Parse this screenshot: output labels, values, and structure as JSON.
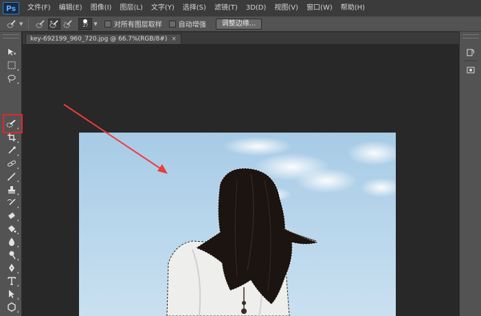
{
  "app": {
    "logo": "Ps"
  },
  "menu": {
    "items": [
      "文件(F)",
      "编辑(E)",
      "图像(I)",
      "图层(L)",
      "文字(Y)",
      "选择(S)",
      "滤镜(T)",
      "3D(D)",
      "视图(V)",
      "窗口(W)",
      "帮助(H)"
    ]
  },
  "options": {
    "brush_size": "27",
    "sample_all_layers": "对所有图层取样",
    "auto_enhance": "自动增强",
    "refine_edge": "调整边缘..."
  },
  "document": {
    "tab_label": "key-692199_960_720.jpg @ 66.7%(RGB/8#)",
    "close_glyph": "×"
  },
  "tools": [
    {
      "name": "move-tool",
      "icon": "move-icon"
    },
    {
      "name": "marquee-tool",
      "icon": "marquee-icon"
    },
    {
      "name": "lasso-tool",
      "icon": "lasso-icon"
    },
    {
      "name": "quick-selection-tool",
      "icon": "quick-selection-icon",
      "active": true
    },
    {
      "name": "crop-tool",
      "icon": "crop-icon"
    },
    {
      "name": "eyedropper-tool",
      "icon": "eyedropper-icon"
    },
    {
      "name": "healing-brush-tool",
      "icon": "healing-icon"
    },
    {
      "name": "brush-tool",
      "icon": "brush-icon"
    },
    {
      "name": "clone-stamp-tool",
      "icon": "stamp-icon"
    },
    {
      "name": "history-brush-tool",
      "icon": "history-brush-icon"
    },
    {
      "name": "eraser-tool",
      "icon": "eraser-icon"
    },
    {
      "name": "paint-bucket-tool",
      "icon": "bucket-icon"
    },
    {
      "name": "blur-tool",
      "icon": "blur-icon"
    },
    {
      "name": "dodge-tool",
      "icon": "dodge-icon"
    },
    {
      "name": "pen-tool",
      "icon": "pen-icon"
    },
    {
      "name": "type-tool",
      "icon": "type-icon"
    },
    {
      "name": "path-selection-tool",
      "icon": "path-select-icon"
    },
    {
      "name": "shape-tool",
      "icon": "shape-icon"
    },
    {
      "name": "hand-tool",
      "icon": "hand-icon"
    },
    {
      "name": "zoom-tool",
      "icon": "zoom-icon"
    }
  ],
  "colors": {
    "highlight": "#e3262a",
    "arrow": "#ee3b3b",
    "sky": "#b9d7ec"
  }
}
